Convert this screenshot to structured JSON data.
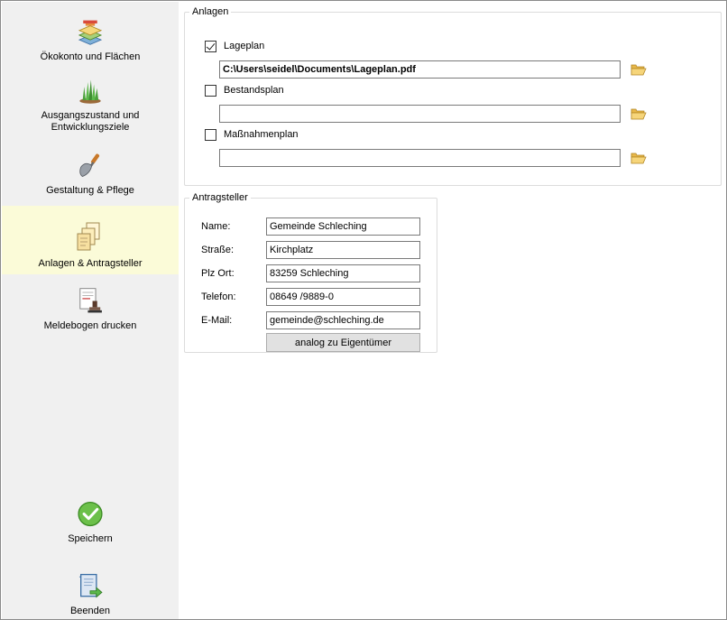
{
  "sidebar": {
    "items": [
      {
        "label": "Ökokonto und Flächen",
        "icon": "layered-map-icon",
        "selected": false
      },
      {
        "label": "Ausgangszustand und\nEntwicklungsziele",
        "icon": "grass-icon",
        "selected": false
      },
      {
        "label": "Gestaltung & Pflege",
        "icon": "trowel-icon",
        "selected": false
      },
      {
        "label": "Anlagen & Antragsteller",
        "icon": "documents-icon",
        "selected": true
      },
      {
        "label": "Meldebogen drucken",
        "icon": "stamp-document-icon",
        "selected": false
      }
    ],
    "save_label": "Speichern",
    "exit_label": "Beenden",
    "highlight_color": "#fbfbd8"
  },
  "anlagen": {
    "legend": "Anlagen",
    "items": [
      {
        "label": "Lageplan",
        "checked": true,
        "value": "C:\\Users\\seidel\\Documents\\Lageplan.pdf"
      },
      {
        "label": "Bestandsplan",
        "checked": false,
        "value": ""
      },
      {
        "label": "Maßnahmenplan",
        "checked": false,
        "value": ""
      }
    ]
  },
  "antragsteller": {
    "legend": "Antragsteller",
    "fields": [
      {
        "label": "Name:",
        "value": "Gemeinde Schleching"
      },
      {
        "label": "Straße:",
        "value": "Kirchplatz"
      },
      {
        "label": "Plz Ort:",
        "value": "83259 Schleching"
      },
      {
        "label": "Telefon:",
        "value": "08649 /9889-0"
      },
      {
        "label": "E-Mail:",
        "value": "gemeinde@schleching.de"
      }
    ],
    "copy_button_label": "analog zu Eigentümer"
  }
}
